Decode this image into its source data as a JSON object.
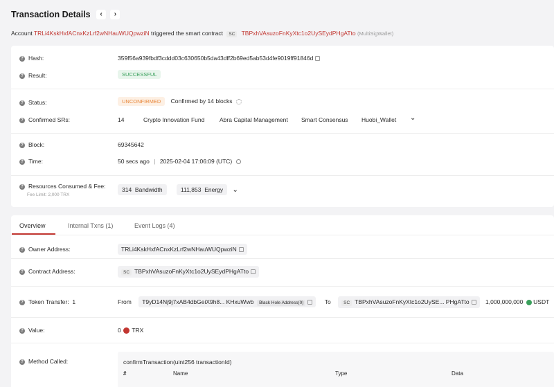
{
  "header": {
    "title": "Transaction Details",
    "prev_icon": "‹",
    "next_icon": "›",
    "account_label": "Account",
    "account_address": "TRLi4KskHxfACnxKzLrf2wNHauWUQpwziN",
    "triggered_text": "triggered the smart contract",
    "sc_badge": "SC",
    "contract_address": "TBPxhVAsuzoFnKyXtc1o2UySEydPHgATto",
    "contract_tag": "(MultiSigWallet)"
  },
  "summary": {
    "hash_label": "Hash:",
    "hash_value": "359f56a939fbdf3cddd03c630650b5da43dff2b69ed5ab53d4fe9019ff91846d",
    "result_label": "Result:",
    "result_value": "SUCCESSFUL",
    "status_label": "Status:",
    "status_value": "UNCONFIRMED",
    "confirmed_text": "Confirmed by 14 blocks",
    "srs_label": "Confirmed SRs:",
    "srs_count": "14",
    "srs": [
      "Crypto Innovation Fund",
      "Abra Capital Management",
      "Smart Consensus",
      "Huobi_Wallet"
    ],
    "block_label": "Block:",
    "block_value": "69345642",
    "time_label": "Time:",
    "time_ago": "50 secs ago",
    "time_sep": "|",
    "time_value": "2025-02-04 17:06:09 (UTC)",
    "resources_label": "Resources Consumed & Fee:",
    "fee_limit": "Fee Limit: 2,000 TRX",
    "bandwidth_value": "314",
    "bandwidth_label": "Bandwidth",
    "energy_value": "111,853",
    "energy_label": "Energy"
  },
  "tabs": [
    "Overview",
    "Internal Txns (1)",
    "Event Logs (4)"
  ],
  "overview": {
    "owner_label": "Owner Address:",
    "owner_value": "TRLi4KskHxfACnxKzLrf2wNHauWUQpwziN",
    "contract_label": "Contract Address:",
    "contract_badge": "SC",
    "contract_value": "TBPxhVAsuzoFnKyXtc1o2UySEydPHgATto",
    "token_label": "Token Transfer:",
    "token_count": "1",
    "from_label": "From",
    "from_value": "T9yD14Nj9j7xAB4dbGeiX9h8... KHxuWwb",
    "from_tag": "Black Hole Address(0)",
    "to_label": "To",
    "to_badge": "SC",
    "to_value": "TBPxhVAsuzoFnKyXtc1o2UySE... PHgATto",
    "amount": "1,000,000,000",
    "token_symbol": "USDT",
    "value_label": "Value:",
    "value_amount": "0",
    "value_symbol": "TRX",
    "method_label": "Method Called:",
    "method_value": "confirmTransaction(uint256 transactionId)",
    "method_cols": [
      "#",
      "Name",
      "Type",
      "Data"
    ]
  },
  "colors": {
    "accent": "#c23631",
    "success": "#3aa05c",
    "warning": "#e8873b"
  }
}
